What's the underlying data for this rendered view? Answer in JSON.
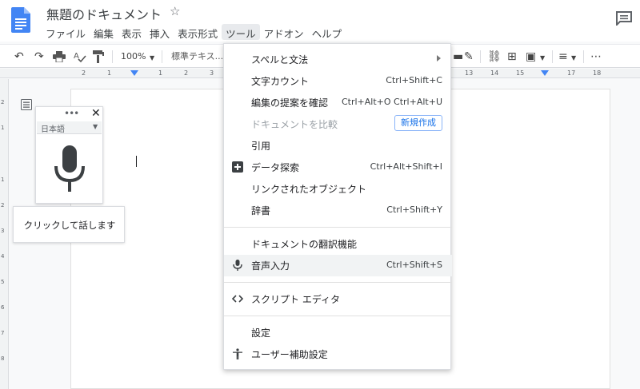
{
  "app": {
    "title": "無題のドキュメント",
    "star": "☆",
    "menus": [
      "ファイル",
      "編集",
      "表示",
      "挿入",
      "表示形式",
      "ツール",
      "アドオン",
      "ヘルプ"
    ],
    "active_menu": "ツール"
  },
  "toolbar": {
    "undo": "↶",
    "redo": "↷",
    "zoom": "100%",
    "style": "標準テキス..."
  },
  "ruler": {
    "left_ticks": [
      "2",
      "1",
      "1",
      "2",
      "3"
    ],
    "right_ticks": [
      "13",
      "14",
      "15",
      "17",
      "18"
    ]
  },
  "vruler": [
    "2",
    "1",
    "1",
    "2",
    "3",
    "4",
    "5",
    "6",
    "7",
    "8"
  ],
  "voice_panel": {
    "dots": "•••",
    "close": "✕",
    "language": "日本語",
    "tooltip": "クリックして話します"
  },
  "tools_menu": {
    "items": [
      {
        "label": "スペルと文法",
        "shortcut": "",
        "submenu": true
      },
      {
        "label": "文字カウント",
        "shortcut": "Ctrl+Shift+C"
      },
      {
        "label": "編集の提案を確認",
        "shortcut": "Ctrl+Alt+O Ctrl+Alt+U"
      },
      {
        "label": "ドキュメントを比較",
        "badge": "新規作成",
        "disabled": true
      },
      {
        "label": "引用",
        "shortcut": ""
      },
      {
        "label": "データ探索",
        "shortcut": "Ctrl+Alt+Shift+I",
        "icon": "explore-icon"
      },
      {
        "label": "リンクされたオブジェクト",
        "shortcut": ""
      },
      {
        "label": "辞書",
        "shortcut": "Ctrl+Shift+Y"
      },
      {
        "label": "ドキュメントの翻訳機能",
        "shortcut": ""
      },
      {
        "label": "音声入力",
        "shortcut": "Ctrl+Shift+S",
        "icon": "mic-icon",
        "highlighted": true
      },
      {
        "label": "スクリプト エディタ",
        "shortcut": "",
        "icon": "code-icon"
      },
      {
        "label": "設定",
        "shortcut": ""
      },
      {
        "label": "ユーザー補助設定",
        "shortcut": "",
        "icon": "accessibility-icon"
      }
    ]
  },
  "colors": {
    "accent": "#4285f4",
    "link": "#1a73e8",
    "highlight_row": "#f1f3f4"
  }
}
